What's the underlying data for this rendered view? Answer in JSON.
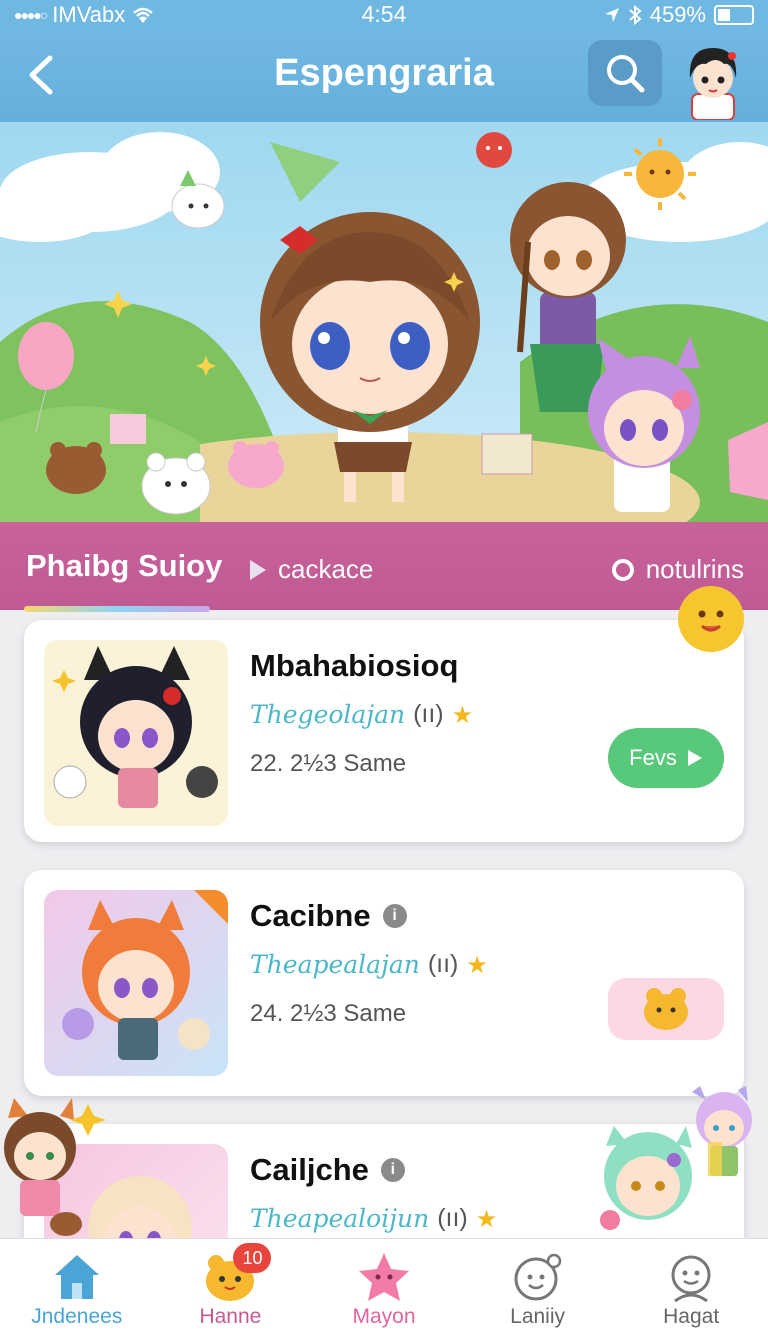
{
  "status_bar": {
    "carrier": "IMVabx",
    "time": "4:54",
    "battery": "459%"
  },
  "header": {
    "title": "Espengraria"
  },
  "category_bar": {
    "title": "Phaibg Suioy",
    "play_label": "cackace",
    "notif_label": "notulrins"
  },
  "games": [
    {
      "name": "Mbahabiosioq",
      "developer": "Thegeolajan",
      "rating_paren": "(ıı)",
      "meta": "22. 2½3 Same",
      "action": "Fevs"
    },
    {
      "name": "Cacibne",
      "developer": "Theapealajan",
      "rating_paren": "(ıı)",
      "meta": "24. 2½3 Same"
    },
    {
      "name": "Cailjche",
      "developer": "Theapealoijun",
      "rating_paren": "(ıı)"
    }
  ],
  "nav": [
    {
      "label": "Jndenees",
      "color": "#4aa5d6"
    },
    {
      "label": "Hanne",
      "color": "#c65a93",
      "badge": "10"
    },
    {
      "label": "Mayon",
      "color": "#e064a0"
    },
    {
      "label": "Laniiy",
      "color": "#666666"
    },
    {
      "label": "Hagat",
      "color": "#666666"
    }
  ],
  "colors": {
    "header": "#6fb8e2",
    "category_bar": "#c05a93",
    "play_button": "#58c97a",
    "developer_text": "#4cb7c9"
  }
}
